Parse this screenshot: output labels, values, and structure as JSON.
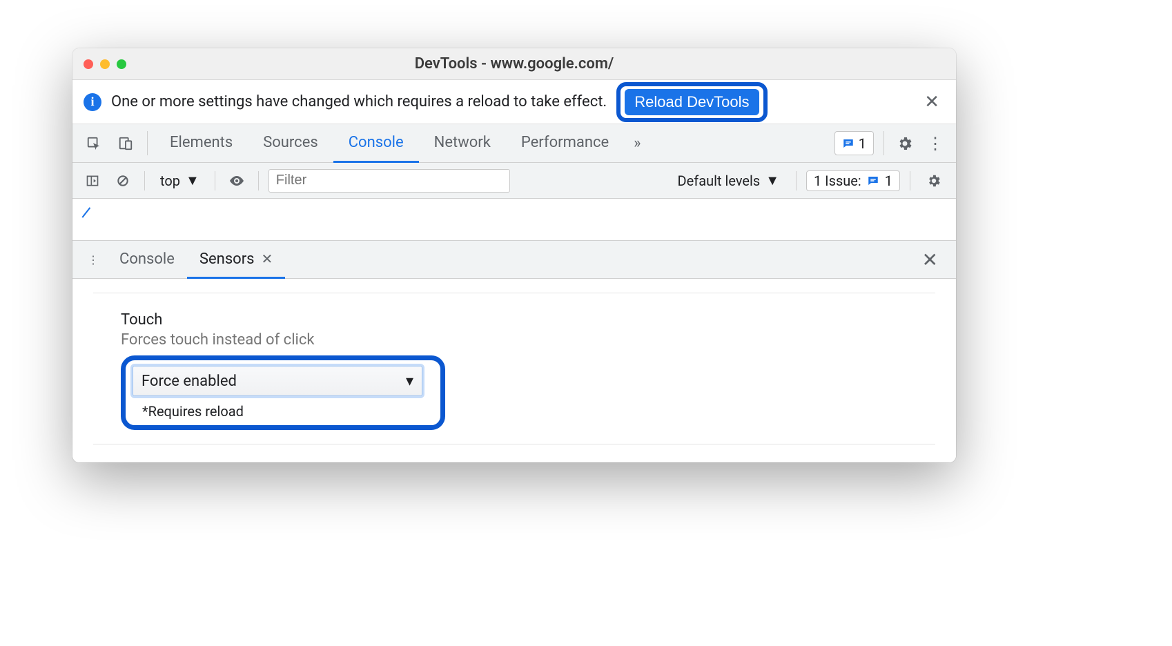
{
  "window": {
    "title": "DevTools - www.google.com/"
  },
  "infobar": {
    "message": "One or more settings have changed which requires a reload to take effect.",
    "action_label": "Reload DevTools"
  },
  "main_tabs": {
    "items": [
      "Elements",
      "Sources",
      "Console",
      "Network",
      "Performance"
    ],
    "active": "Console",
    "issue_count": "1"
  },
  "console_toolbar": {
    "context": "top",
    "filter_placeholder": "Filter",
    "levels": "Default levels",
    "issues_label": "1 Issue:",
    "issues_count": "1"
  },
  "drawer": {
    "tabs": [
      "Console",
      "Sensors"
    ],
    "active": "Sensors"
  },
  "sensors": {
    "touch": {
      "title": "Touch",
      "description": "Forces touch instead of click",
      "value": "Force enabled",
      "footnote": "*Requires reload"
    }
  }
}
